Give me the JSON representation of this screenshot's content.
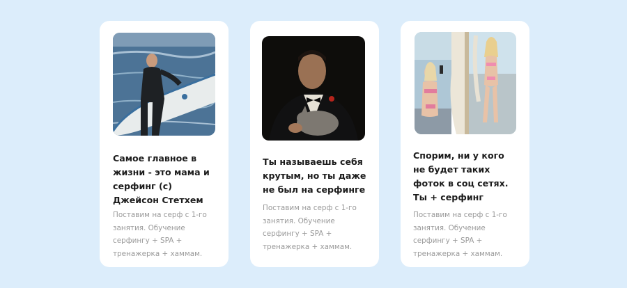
{
  "cards": [
    {
      "title": "Самое главное в жизни - это мама и серфинг (с) Джейсон Стетхем",
      "description": "Поставим на серф с 1-го занятия. Обучение серфингу + SPA + тренажерка + хаммам."
    },
    {
      "title": "Ты называешь себя крутым, но ты даже не был на серфинге",
      "description": "Поставим на серф с 1-го занятия. Обучение серфингу + SPA + тренажерка + хаммам."
    },
    {
      "title": "Спорим, ни у кого не будет таких фоток в соц сетях. Ты + серфинг",
      "description": "Поставим на серф с 1-го занятия. Обучение серфингу + SPA + тренажерка + хаммам."
    }
  ]
}
